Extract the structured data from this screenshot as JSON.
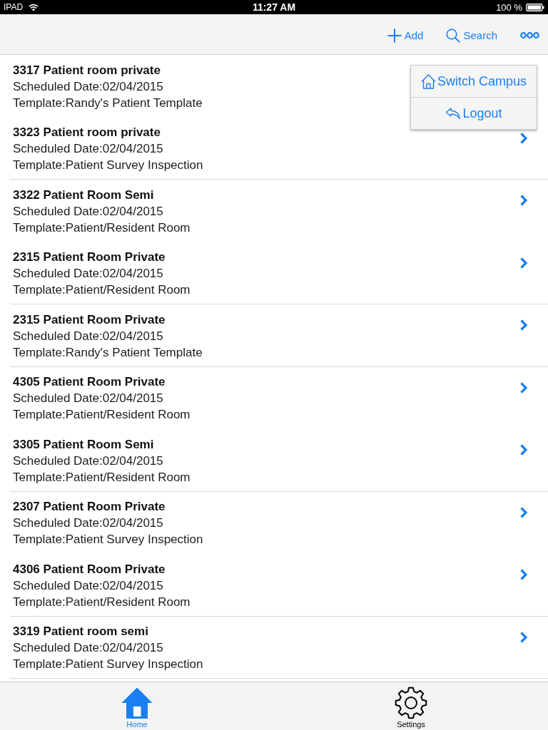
{
  "status_bar": {
    "device": "IPAD",
    "time": "11:27 AM",
    "battery": "100 %"
  },
  "nav_bar": {
    "actions": [
      {
        "kind": "add",
        "label": "Add"
      },
      {
        "kind": "search",
        "label": "Search"
      },
      {
        "kind": "more"
      }
    ]
  },
  "menu": {
    "items": [
      {
        "kind": "campus",
        "label": "Switch Campus"
      },
      {
        "kind": "logout",
        "label": "Logout"
      }
    ]
  },
  "inspections": [
    {
      "title": "3317 Patient room private",
      "scheduled": "Scheduled Date:02/04/2015",
      "template": "Template:Randy's Patient Template",
      "divider": false
    },
    {
      "title": "3323 Patient room private",
      "scheduled": "Scheduled Date:02/04/2015",
      "template": "Template:Patient Survey Inspection",
      "divider": true
    },
    {
      "title": "3322 Patient Room Semi",
      "scheduled": "Scheduled Date:02/04/2015",
      "template": "Template:Patient/Resident Room",
      "divider": false
    },
    {
      "title": "2315 Patient Room Private",
      "scheduled": "Scheduled Date:02/04/2015",
      "template": "Template:Patient/Resident Room",
      "divider": true
    },
    {
      "title": "2315 Patient Room Private",
      "scheduled": "Scheduled Date:02/04/2015",
      "template": "Template:Randy's Patient Template",
      "divider": true
    },
    {
      "title": "4305 Patient Room Private",
      "scheduled": "Scheduled Date:02/04/2015",
      "template": "Template:Patient/Resident Room",
      "divider": false
    },
    {
      "title": "3305 Patient Room Semi",
      "scheduled": "Scheduled Date:02/04/2015",
      "template": "Template:Patient/Resident Room",
      "divider": true
    },
    {
      "title": "2307 Patient Room Private",
      "scheduled": "Scheduled Date:02/04/2015",
      "template": "Template:Patient Survey Inspection",
      "divider": false
    },
    {
      "title": "4306 Patient Room Private",
      "scheduled": "Scheduled Date:02/04/2015",
      "template": "Template:Patient/Resident Room",
      "divider": true
    },
    {
      "title": "3319 Patient room semi",
      "scheduled": "Scheduled Date:02/04/2015",
      "template": "Template:Patient Survey Inspection",
      "divider": true
    }
  ],
  "tab_bar": {
    "tabs": [
      {
        "kind": "home",
        "label": "Home",
        "selected": true
      },
      {
        "kind": "settings",
        "label": "Settings",
        "selected": false
      }
    ]
  }
}
